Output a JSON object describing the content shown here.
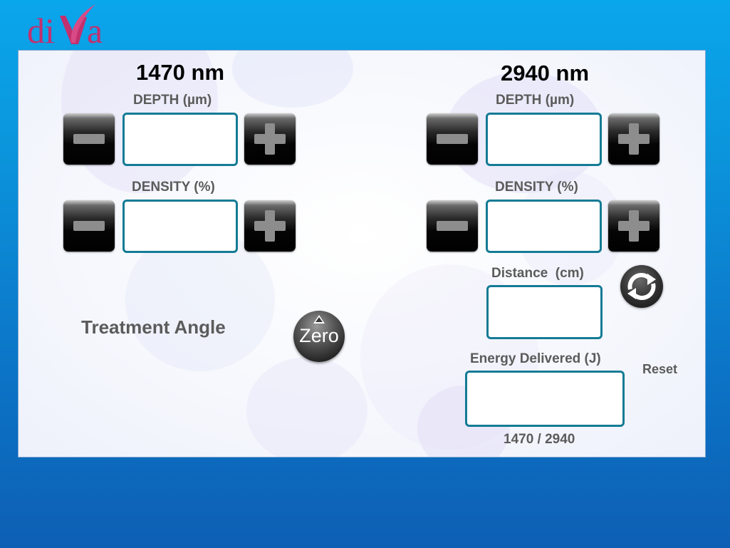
{
  "brand": {
    "logo_text": "diVa",
    "colors": {
      "logo": "#c2306e",
      "accent": "#147b95"
    }
  },
  "left": {
    "title": "1470 nm",
    "depth": {
      "label": "DEPTH",
      "unit": "(µm)",
      "value": ""
    },
    "density": {
      "label": "DENSITY",
      "unit": "(%)",
      "value": ""
    },
    "treatment_angle_label": "Treatment Angle"
  },
  "right": {
    "title": "2940 nm",
    "depth": {
      "label": "DEPTH",
      "unit": "(µm)",
      "value": ""
    },
    "density": {
      "label": "DENSITY",
      "unit": "(%)",
      "value": ""
    },
    "distance": {
      "label": "Distance",
      "unit": "(cm)",
      "value": ""
    },
    "energy": {
      "label": "Energy Delivered",
      "unit": "(J)",
      "value": "",
      "footer": "1470 / 2940"
    }
  },
  "zero_button": {
    "label": "Zero"
  },
  "reset_button": {
    "label": "Reset"
  },
  "icons": {
    "decrease": "minus-icon",
    "increase": "plus-icon",
    "reset": "reset-arrows-icon",
    "zero": "triangle-up-icon"
  }
}
